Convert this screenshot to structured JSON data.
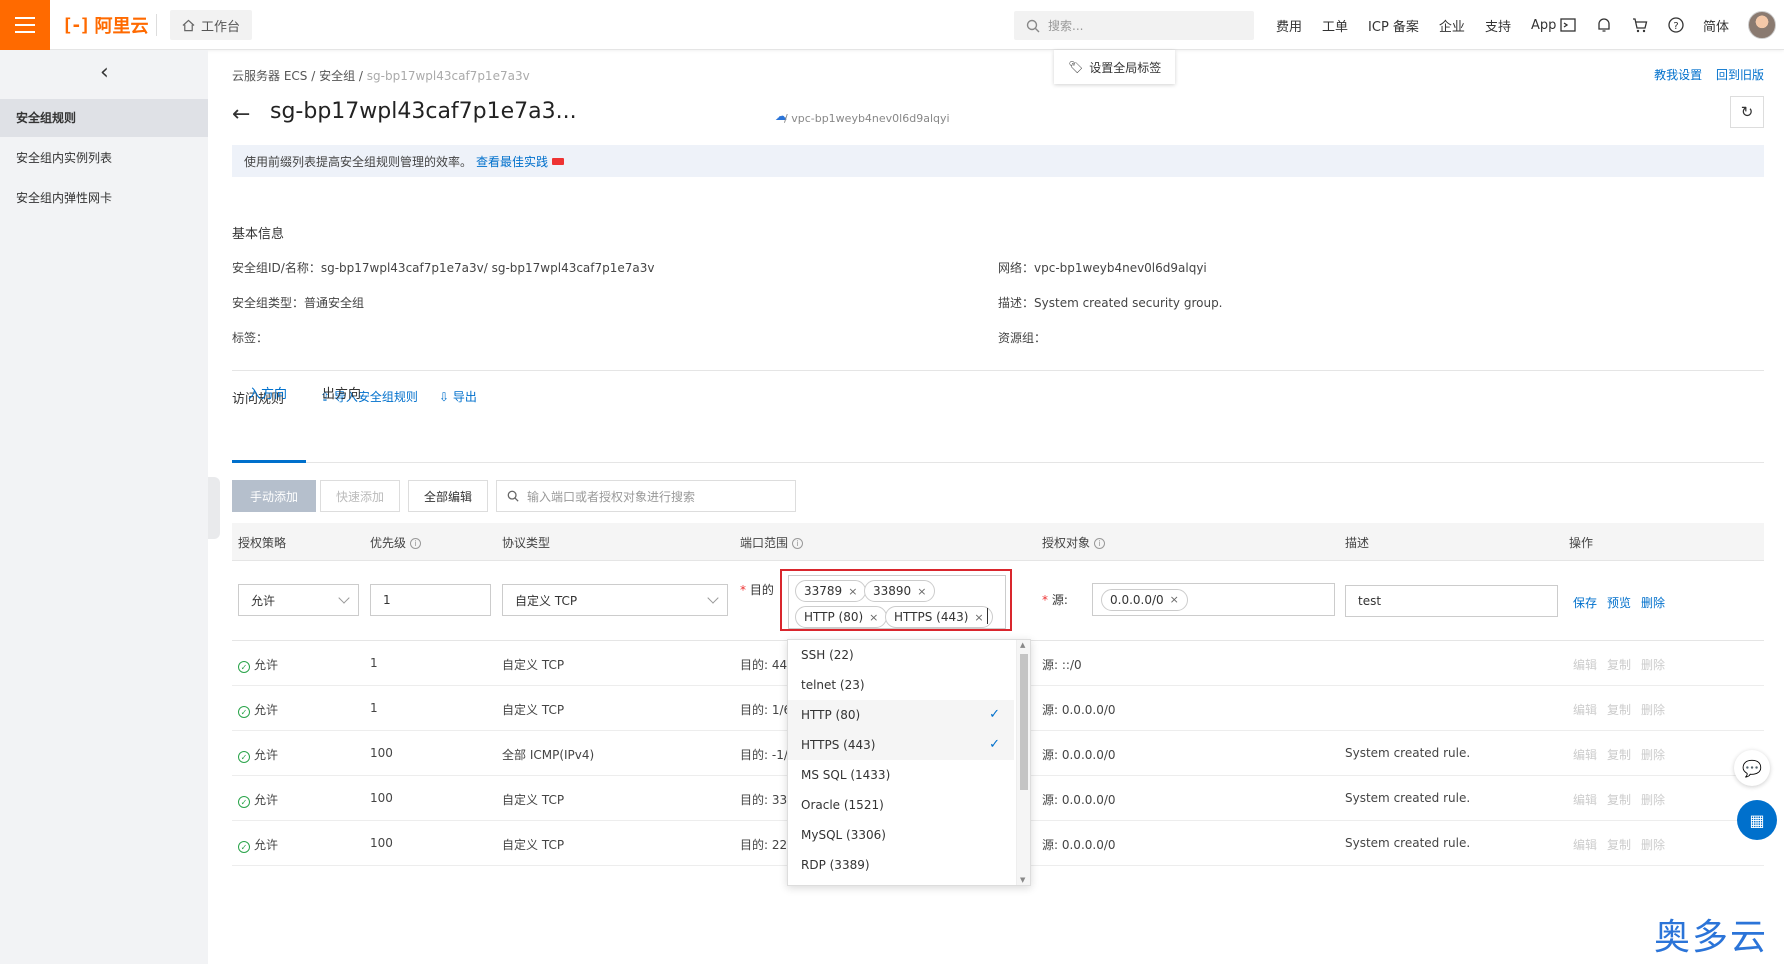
{
  "topbar": {
    "brand": "阿里云",
    "workbench": "工作台",
    "search_placeholder": "搜索...",
    "nav": [
      "费用",
      "工单",
      "ICP 备案",
      "企业",
      "支持",
      "App"
    ],
    "lang": "简体"
  },
  "sidebar": {
    "items": [
      {
        "label": "安全组规则",
        "active": true
      },
      {
        "label": "安全组内实例列表",
        "active": false
      },
      {
        "label": "安全组内弹性网卡",
        "active": false
      }
    ]
  },
  "header": {
    "breadcrumb": [
      "云服务器 ECS",
      "安全组",
      "sg-bp17wpl43caf7p1e7a3v"
    ],
    "global_tag_btn": "设置全局标签",
    "teach_link": "教我设置",
    "old_version_link": "回到旧版",
    "title": "sg-bp17wpl43caf7p1e7a3...",
    "vpc": "/ vpc-bp1weyb4nev0l6d9alqyi"
  },
  "notice": {
    "text": "使用前缀列表提高安全组规则管理的效率。",
    "link": "查看最佳实践"
  },
  "basic_info": {
    "title": "基本信息",
    "sg_id_label": "安全组ID/名称：",
    "sg_id_value": "sg-bp17wpl43caf7p1e7a3v/ sg-bp17wpl43caf7p1e7a3v",
    "sg_type_label": "安全组类型：",
    "sg_type_value": "普通安全组",
    "tag_label": "标签：",
    "network_label": "网络：",
    "network_value": "vpc-bp1weyb4nev0l6d9alqyi",
    "desc_label": "描述：",
    "desc_value": "System created security group.",
    "rg_label": "资源组："
  },
  "rules": {
    "title": "访问规则",
    "import": "导入安全组规则",
    "export": "导出",
    "tabs": [
      "入方向",
      "出方向"
    ],
    "btn_manual": "手动添加",
    "btn_quick": "快速添加",
    "btn_edit_all": "全部编辑",
    "search_placeholder": "输入端口或者授权对象进行搜索",
    "columns": [
      "授权策略",
      "优先级",
      "协议类型",
      "端口范围",
      "授权对象",
      "描述",
      "操作"
    ]
  },
  "edit_row": {
    "policy": "允许",
    "priority": "1",
    "protocol": "自定义 TCP",
    "dest_label": "目的",
    "port_chips": [
      "33789",
      "33890",
      "HTTP (80)",
      "HTTPS (443)"
    ],
    "source_label": "源:",
    "source_chip": "0.0.0.0/0",
    "desc": "test",
    "ops": [
      "保存",
      "预览",
      "删除"
    ]
  },
  "rows": [
    {
      "policy": "允许",
      "priority": "1",
      "protocol": "自定义 TCP",
      "port": "目的: 443",
      "source": "源: ::/0",
      "desc": ""
    },
    {
      "policy": "允许",
      "priority": "1",
      "protocol": "自定义 TCP",
      "port": "目的: 1/6",
      "source": "源: 0.0.0.0/0",
      "desc": ""
    },
    {
      "policy": "允许",
      "priority": "100",
      "protocol": "全部 ICMP(IPv4)",
      "port": "目的: -1/-",
      "source": "源: 0.0.0.0/0",
      "desc": "System created rule."
    },
    {
      "policy": "允许",
      "priority": "100",
      "protocol": "自定义 TCP",
      "port": "目的: 338",
      "source": "源: 0.0.0.0/0",
      "desc": "System created rule."
    },
    {
      "policy": "允许",
      "priority": "100",
      "protocol": "自定义 TCP",
      "port": "目的: 22/",
      "source": "源: 0.0.0.0/0",
      "desc": "System created rule."
    }
  ],
  "row_ops": [
    "编辑",
    "复制",
    "删除"
  ],
  "dropdown": {
    "options": [
      {
        "label": "SSH (22)",
        "checked": false
      },
      {
        "label": "telnet (23)",
        "checked": false
      },
      {
        "label": "HTTP (80)",
        "checked": true
      },
      {
        "label": "HTTPS (443)",
        "checked": true
      },
      {
        "label": "MS SQL (1433)",
        "checked": false
      },
      {
        "label": "Oracle (1521)",
        "checked": false
      },
      {
        "label": "MySQL (3306)",
        "checked": false
      },
      {
        "label": "RDP (3389)",
        "checked": false
      }
    ]
  },
  "watermark": "奥多云",
  "colors": {
    "brand": "#ff6a00",
    "link": "#0070cc",
    "highlight_border": "#d9262d"
  }
}
